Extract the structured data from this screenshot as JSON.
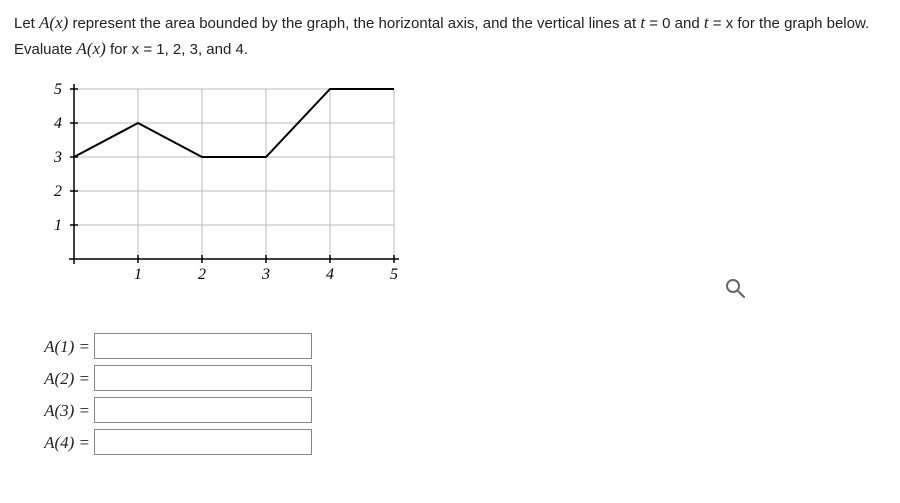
{
  "problem": {
    "line1_pre": "Let ",
    "line1_fn": "A(x)",
    "line1_mid": " represent the area bounded by the graph, the horizontal axis, and the vertical lines at ",
    "line1_t": "t",
    "line1_eq0": " = 0 and ",
    "line1_t2": "t",
    "line2_pre": " = x for the graph below. Evaluate ",
    "line2_fn": "A(x)",
    "line2_post": " for x = 1, 2, 3, and 4."
  },
  "chart_data": {
    "type": "line",
    "x": [
      0,
      1,
      2,
      3,
      4,
      5
    ],
    "y": [
      3,
      4,
      3,
      3,
      5,
      5
    ],
    "xlabel": "",
    "ylabel": "",
    "xlim": [
      0,
      5
    ],
    "ylim": [
      0,
      5
    ],
    "xticks": [
      1,
      2,
      3,
      4,
      5
    ],
    "yticks": [
      1,
      2,
      3,
      4,
      5
    ]
  },
  "answers": [
    {
      "label": "A(1) =",
      "value": ""
    },
    {
      "label": "A(2) =",
      "value": ""
    },
    {
      "label": "A(3) =",
      "value": ""
    },
    {
      "label": "A(4) =",
      "value": ""
    }
  ]
}
